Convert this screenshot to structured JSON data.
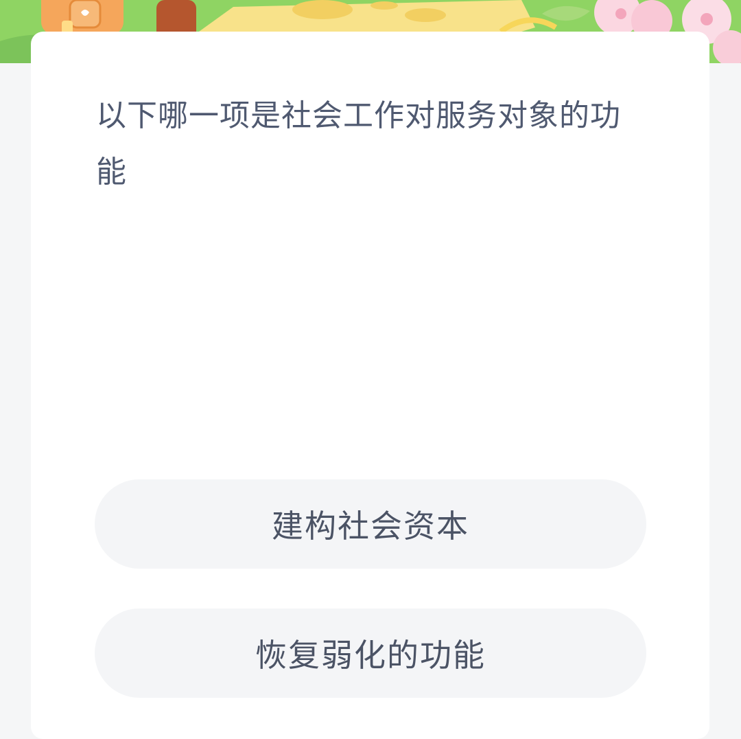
{
  "question": {
    "text": "以下哪一项是社会工作对服务对象的功能"
  },
  "options": [
    {
      "label": "建构社会资本"
    },
    {
      "label": "恢复弱化的功能"
    }
  ],
  "colors": {
    "page_background": "#f5f6f7",
    "card_background": "#ffffff",
    "option_background": "#f4f5f7",
    "question_text": "#4f5970",
    "option_text": "#4b5365",
    "banner_green": "#8fd463"
  }
}
